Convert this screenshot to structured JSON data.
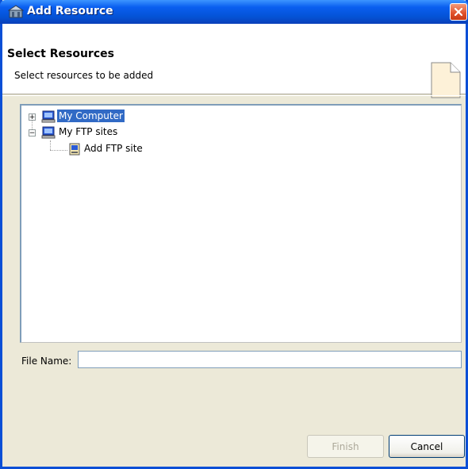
{
  "window": {
    "title": "Add Resource",
    "title_icon": "resource-icon",
    "close_icon": "close-icon"
  },
  "banner": {
    "title": "Select Resources",
    "description": "Select resources to be added",
    "icon": "blank-page-icon"
  },
  "tree": {
    "nodes": [
      {
        "label": "My Computer",
        "icon": "computer-icon",
        "expander": "+",
        "selected": true
      },
      {
        "label": "My FTP sites",
        "icon": "computer-icon",
        "expander": "−",
        "selected": false
      },
      {
        "label": "Add FTP site",
        "icon": "ftp-site-icon",
        "selected": false
      }
    ]
  },
  "file_name": {
    "label": "File Name:",
    "value": ""
  },
  "buttons": {
    "finish": "Finish",
    "cancel": "Cancel"
  },
  "colors": {
    "title_bar": "#0a5ff0",
    "close_button": "#e0502a",
    "selection": "#316ac5",
    "dialog_bg": "#ece9d8"
  }
}
